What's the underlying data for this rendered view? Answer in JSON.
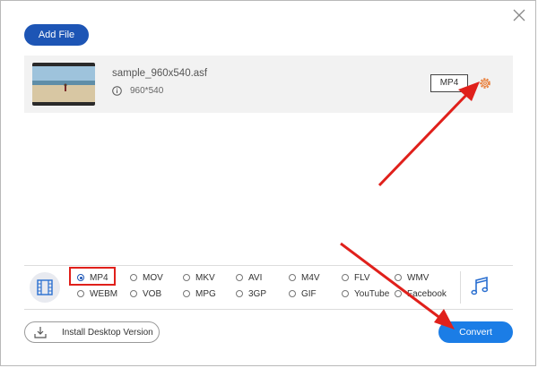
{
  "window": {
    "close_icon": "close-icon"
  },
  "toolbar": {
    "add_file_label": "Add File"
  },
  "file": {
    "name": "sample_960x540.asf",
    "resolution": "960*540",
    "output_format": "MP4",
    "settings_icon": "gear-icon"
  },
  "formats": {
    "row1": [
      "MP4",
      "MOV",
      "MKV",
      "AVI",
      "M4V",
      "FLV",
      "WMV"
    ],
    "row2": [
      "WEBM",
      "VOB",
      "MPG",
      "3GP",
      "GIF",
      "YouTube",
      "Facebook"
    ],
    "selected": "MP4"
  },
  "footer": {
    "install_label": "Install Desktop Version",
    "convert_label": "Convert"
  },
  "colors": {
    "primary": "#1d55b5",
    "convert": "#1b7de6",
    "annotation": "#e0201b"
  }
}
